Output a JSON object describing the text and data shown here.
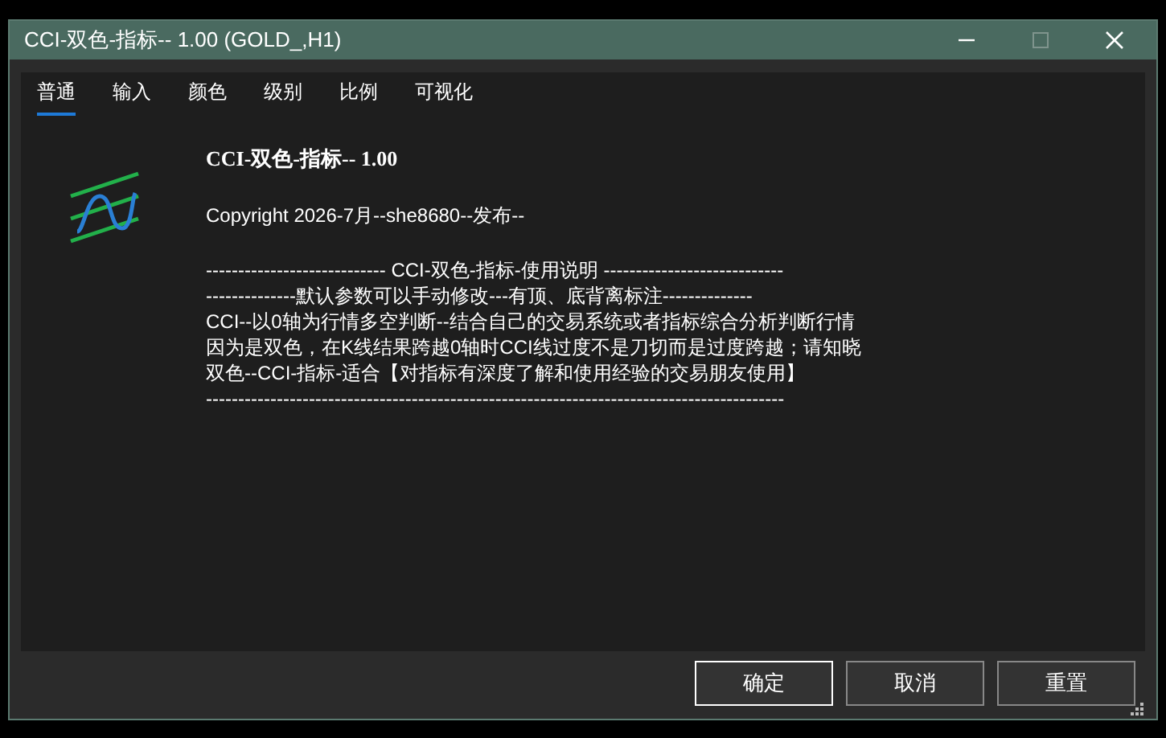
{
  "window": {
    "title": "CCI-双色-指标-- 1.00 (GOLD_,H1)"
  },
  "tabs": [
    {
      "label": "普通",
      "selected": true
    },
    {
      "label": "输入",
      "selected": false
    },
    {
      "label": "颜色",
      "selected": false
    },
    {
      "label": "级别",
      "selected": false
    },
    {
      "label": "比例",
      "selected": false
    },
    {
      "label": "可视化",
      "selected": false
    }
  ],
  "about": {
    "name": "CCI-双色-指标-- 1.00",
    "copyright": "Copyright 2026-7月--she8680--发布--",
    "description": [
      "---------------------------- CCI-双色-指标-使用说明 ----------------------------",
      "--------------默认参数可以手动修改---有顶、底背离标注--------------",
      "CCI--以0轴为行情多空判断--结合自己的交易系统或者指标综合分析判断行情",
      "因为是双色，在K线结果跨越0轴时CCI线过度不是刀切而是过度跨越；请知晓",
      "双色--CCI-指标-适合【对指标有深度了解和使用经验的交易朋友使用】",
      "------------------------------------------------------------------------------------------"
    ]
  },
  "buttons": [
    {
      "label": "确定",
      "default": true
    },
    {
      "label": "取消",
      "default": false
    },
    {
      "label": "重置",
      "default": false
    }
  ]
}
